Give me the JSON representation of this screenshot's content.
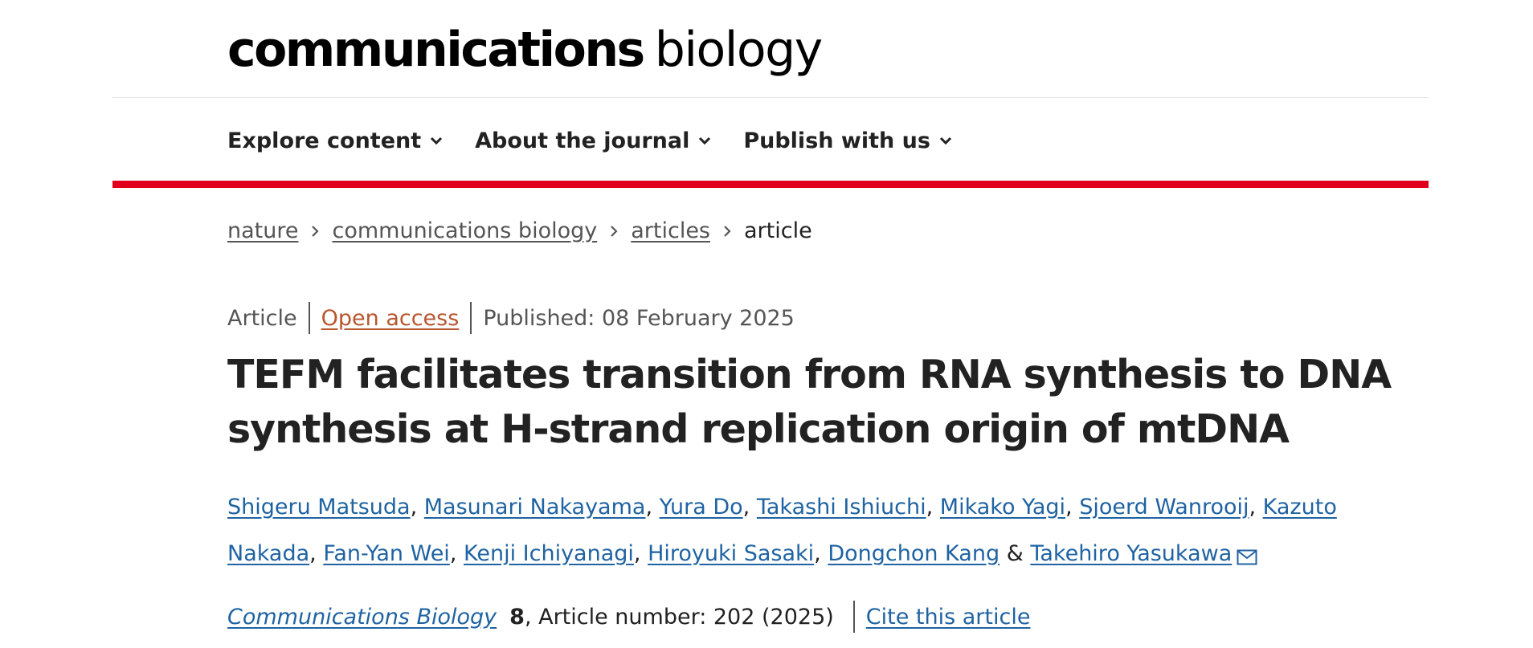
{
  "header": {
    "logo_bold": "communications",
    "logo_light": "biology"
  },
  "nav": {
    "items": [
      {
        "label": "Explore content",
        "icon": "chevron-down-icon"
      },
      {
        "label": "About the journal",
        "icon": "chevron-down-icon"
      },
      {
        "label": "Publish with us",
        "icon": "chevron-down-icon"
      }
    ]
  },
  "colors": {
    "accent_red": "#e0001b",
    "link_blue": "#1f63a2",
    "open_access_orange": "#b8562f"
  },
  "breadcrumb": {
    "items": [
      "nature",
      "communications biology",
      "articles"
    ],
    "current": "article"
  },
  "meta": {
    "type": "Article",
    "open_access": "Open access",
    "published": "Published: 08 February 2025"
  },
  "article": {
    "title": "TEFM facilitates transition from RNA synthesis to DNA synthesis at H-strand replication origin of mtDNA",
    "authors": [
      "Shigeru Matsuda",
      "Masunari Nakayama",
      "Yura Do",
      "Takashi Ishiuchi",
      "Mikako Yagi",
      "Sjoerd Wanrooij",
      "Kazuto Nakada",
      "Fan-Yan Wei",
      "Kenji Ichiyanagi",
      "Hiroyuki Sasaki",
      "Dongchon Kang",
      "Takehiro Yasukawa"
    ],
    "authors_joiner": "&",
    "corresponding_icon": "mail-icon"
  },
  "citation": {
    "journal": "Communications Biology",
    "volume": "8",
    "article_number": ", Article number: 202 (2025)",
    "cite_link": "Cite this article"
  }
}
